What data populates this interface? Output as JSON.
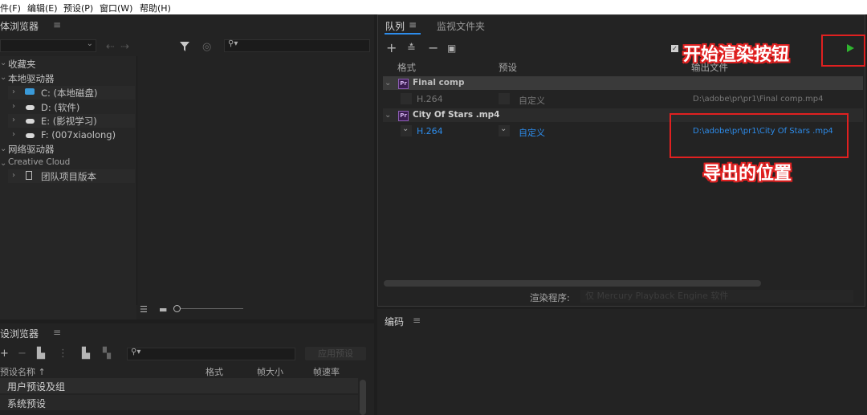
{
  "menubar": {
    "items": [
      "件(F)",
      "编辑(E)",
      "预设(P)",
      "窗口(W)",
      "帮助(H)"
    ]
  },
  "media_browser": {
    "title": "媒体浏览器",
    "title_visible": "媒体浏览器",
    "menu_icon": "≡",
    "search_placeholder": "",
    "tree": {
      "favorites": "收藏夹",
      "local_drives": "本地驱动器",
      "drives": [
        "C: (本地磁盘)",
        "D: (软件)",
        "E: (影视学习)",
        "F: (007xiaolong)"
      ],
      "network_drives": "网络驱动器",
      "creative_cloud": "Creative Cloud",
      "team_versions": "团队项目版本"
    }
  },
  "preset_browser": {
    "title": "预设浏览器",
    "apply_button": "应用预设",
    "columns": [
      "预设名称 ↑",
      "格式",
      "帧大小",
      "帧速率"
    ],
    "rows": [
      "用户预设及组",
      "系统预设"
    ]
  },
  "queue_panel": {
    "tabs": [
      "队列",
      "监视文件夹"
    ],
    "columns": {
      "format": "格式",
      "preset": "预设",
      "output": "输出文件"
    },
    "groups": [
      {
        "name": "Final comp",
        "format": "H.264",
        "preset": "自定义",
        "output": "D:\\adobe\\pr\\pr1\\Final comp.mp4",
        "active": false
      },
      {
        "name": "City Of Stars .mp4",
        "format": "H.264",
        "preset": "自定义",
        "output": "D:\\adobe\\pr\\pr1\\City Of Stars .mp4",
        "active": true
      }
    ],
    "renderer_label": "渲染程序:",
    "renderer_value": "仅 Mercury Playback Engine 软件"
  },
  "encode_panel": {
    "title": "编码"
  },
  "annotations": {
    "start_render": "开始渲染按钮",
    "export_location": "导出的位置"
  },
  "colors": {
    "accent_blue": "#2d8ceb",
    "play_green": "#2fb52f",
    "annotation_red": "#e02020",
    "panel_bg": "#232323"
  }
}
